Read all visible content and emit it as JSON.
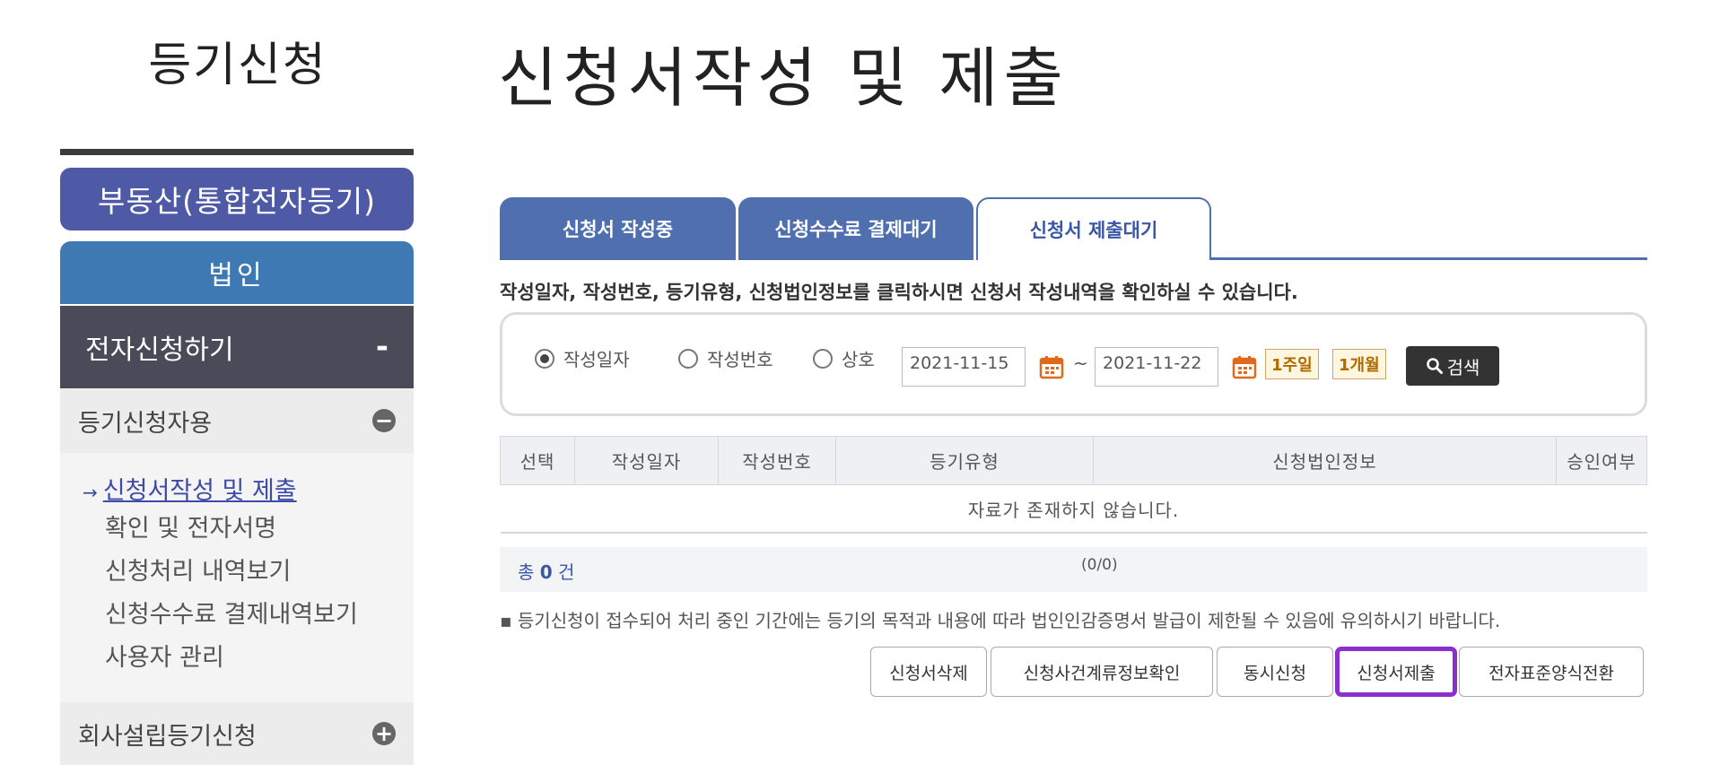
{
  "sidebar": {
    "title": "등기신청",
    "menu_realty": "부동산(통합전자등기)",
    "menu_corp": "법인",
    "menu_esubmit": "전자신청하기",
    "menu_esubmit_toggle": "-",
    "section_registration": "등기신청자용",
    "links": [
      "신청서작성 및 제출",
      "확인 및 전자서명",
      "신청처리 내역보기",
      "신청수수료 결제내역보기",
      "사용자 관리"
    ],
    "active_arrow": "→",
    "section_company": "회사설립등기신청"
  },
  "main": {
    "title": "신청서작성 및 제출",
    "tabs": [
      "신청서 작성중",
      "신청수수료 결제대기",
      "신청서 제출대기"
    ],
    "active_tab": 2,
    "notice": "작성일자, 작성번호, 등기유형, 신청법인정보를 클릭하시면 신청서 작성내역을 확인하실 수 있습니다.",
    "search": {
      "radios": [
        "작성일자",
        "작성번호",
        "상호"
      ],
      "selected_radio": 0,
      "date_from": "2021-11-15",
      "date_to": "2021-11-22",
      "tilde": "~",
      "week_button": "1주일",
      "month_button": "1개월",
      "search_button": "검색"
    },
    "table": {
      "headers": [
        "선택",
        "작성일자",
        "작성번호",
        "등기유형",
        "신청법인정보",
        "승인여부"
      ],
      "empty_message": "자료가 존재하지 않습니다."
    },
    "total_prefix": "총",
    "total_count": "0",
    "total_suffix": "건",
    "page_info": "(0/0)",
    "warning": "▪ 등기신청이 접수되어 처리 중인 기간에는 등기의 목적과 내용에 따라 법인인감증명서 발급이 제한될 수 있음에 유의하시기 바랍니다.",
    "actions": [
      "신청서삭제",
      "신청사건계류정보확인",
      "동시신청",
      "신청서제출",
      "전자표준양식전환"
    ],
    "highlighted_action": 3
  },
  "colors": {
    "realty": "#4e5aa6",
    "corp": "#3f79b3",
    "esubmit": "#4a4a58",
    "tab": "#4f6fae",
    "highlight": "#8b2fd0"
  }
}
